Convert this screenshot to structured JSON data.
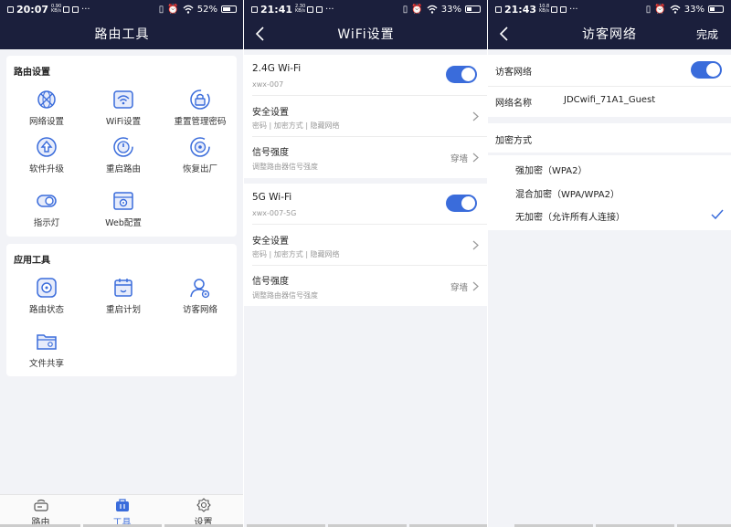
{
  "colors": {
    "navbar": "#1b1f3c",
    "accent": "#3a6cdb",
    "background": "#f2f3f7"
  },
  "panel1": {
    "status": {
      "time": "20:07",
      "rate_top": "0.90",
      "rate_bottom": "KB/s",
      "battery": "52%"
    },
    "title": "路由工具",
    "router_settings": {
      "title": "路由设置",
      "items": [
        {
          "label": "网络设置",
          "icon": "globe-icon"
        },
        {
          "label": "WiFi设置",
          "icon": "wifi-icon"
        },
        {
          "label": "重置管理密码",
          "icon": "lock-reset-icon"
        },
        {
          "label": "软件升级",
          "icon": "upgrade-icon"
        },
        {
          "label": "重启路由",
          "icon": "power-restart-icon"
        },
        {
          "label": "恢复出厂",
          "icon": "factory-reset-icon"
        },
        {
          "label": "指示灯",
          "icon": "light-toggle-icon"
        },
        {
          "label": "Web配置",
          "icon": "web-config-icon"
        }
      ]
    },
    "app_tools": {
      "title": "应用工具",
      "items": [
        {
          "label": "路由状态",
          "icon": "router-status-icon"
        },
        {
          "label": "重启计划",
          "icon": "calendar-icon"
        },
        {
          "label": "访客网络",
          "icon": "guest-user-icon"
        },
        {
          "label": "文件共享",
          "icon": "folder-share-icon"
        }
      ]
    },
    "tabs": [
      {
        "label": "路由",
        "icon": "router-icon",
        "active": false
      },
      {
        "label": "工具",
        "icon": "toolbox-icon",
        "active": true
      },
      {
        "label": "设置",
        "icon": "gear-icon",
        "active": false
      }
    ]
  },
  "panel2": {
    "status": {
      "time": "21:41",
      "rate_top": "2.30",
      "rate_bottom": "KB/s",
      "battery": "33%"
    },
    "title": "WiFi设置",
    "wifi_24": {
      "name": "2.4G Wi-Fi",
      "ssid": "xwx-007",
      "enabled": true,
      "security_title": "安全设置",
      "security_sub": "密码 | 加密方式 | 隐藏网络",
      "signal_title": "信号强度",
      "signal_sub": "调整路由器信号强度",
      "signal_value": "穿墙"
    },
    "wifi_5": {
      "name": "5G Wi-Fi",
      "ssid": "xwx-007-5G",
      "enabled": true,
      "security_title": "安全设置",
      "security_sub": "密码 | 加密方式 | 隐藏网络",
      "signal_title": "信号强度",
      "signal_sub": "调整路由器信号强度",
      "signal_value": "穿墙"
    }
  },
  "panel3": {
    "status": {
      "time": "21:43",
      "rate_top": "10.8",
      "rate_bottom": "KB/s",
      "battery": "33%"
    },
    "title": "访客网络",
    "done_label": "完成",
    "guest_label": "访客网络",
    "guest_enabled": true,
    "name_label": "网络名称",
    "name_value": "JDCwifi_71A1_Guest",
    "encryption_label": "加密方式",
    "options": [
      {
        "label": "强加密（WPA2）",
        "selected": false
      },
      {
        "label": "混合加密（WPA/WPA2）",
        "selected": false
      },
      {
        "label": "无加密（允许所有人连接）",
        "selected": true
      }
    ]
  }
}
